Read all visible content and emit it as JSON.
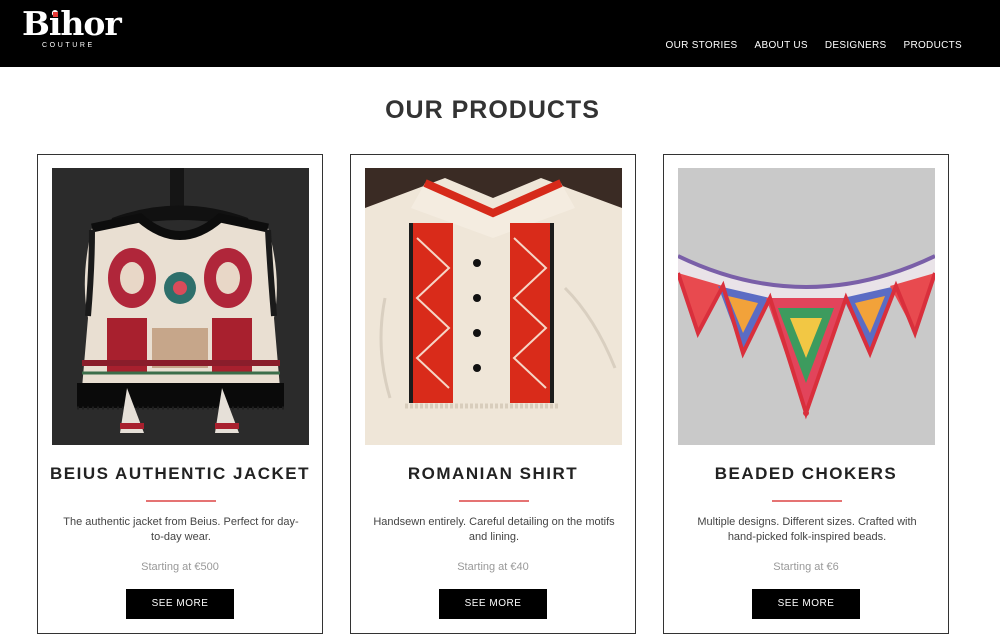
{
  "brand": {
    "name": "Bihor",
    "tagline": "COUTURE"
  },
  "nav": {
    "items": [
      "OUR STORIES",
      "ABOUT US",
      "DESIGNERS",
      "PRODUCTS"
    ]
  },
  "section": {
    "title": "OUR PRODUCTS"
  },
  "products": [
    {
      "title": "BEIUS AUTHENTIC JACKET",
      "description": "The authentic jacket from Beius. Perfect for day-to-day wear.",
      "price": "Starting at €500",
      "button": "SEE MORE"
    },
    {
      "title": "ROMANIAN SHIRT",
      "description": "Handsewn entirely. Careful detailing on the motifs and lining.",
      "price": "Starting at €40",
      "button": "SEE MORE"
    },
    {
      "title": "BEADED CHOKERS",
      "description": "Multiple designs. Different sizes. Crafted with hand-picked folk-inspired beads.",
      "price": "Starting at €6",
      "button": "SEE MORE"
    }
  ],
  "colors": {
    "header_bg": "#000000",
    "accent": "#e57373",
    "button_bg": "#000000"
  }
}
